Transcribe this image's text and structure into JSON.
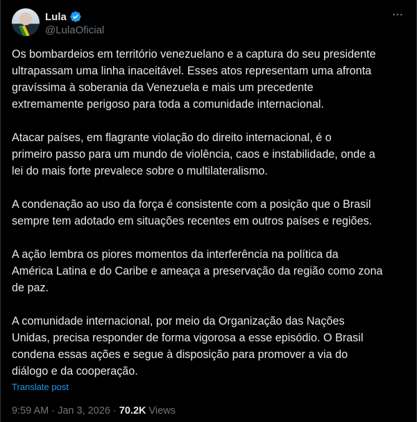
{
  "author": {
    "display_name": "Lula",
    "handle": "@LulaOficial",
    "verified": true,
    "verified_color": "#1d9bf0"
  },
  "paragraphs": [
    "Os bombardeios em território venezuelano e a captura do seu presidente\nultrapassam uma linha inaceitável. Esses atos representam uma afronta\ngravíssima à soberania da Venezuela e mais um precedente\nextremamente perigoso para toda a comunidade internacional.",
    "Atacar países, em flagrante violação do direito internacional, é o\nprimeiro passo para um mundo de violência, caos e instabilidade, onde a\nlei do mais forte prevalece sobre o multilateralismo.",
    "A condenação ao uso da força é consistente com a posição que o Brasil\nsempre tem adotado em situações recentes em outros países e regiões.",
    "A ação lembra os piores momentos da interferência na política da\nAmérica Latina e do Caribe e ameaça a preservação da região como zona\nde paz.",
    "A comunidade internacional, por meio da Organização das Nações\nUnidas, precisa responder de forma vigorosa a esse episódio. O Brasil\ncondena essas ações e segue à disposição para promover a via do\ndiálogo e da cooperação."
  ],
  "translate_label": "Translate post",
  "meta": {
    "time": "9:59 AM",
    "separator": " · ",
    "date": "Jan 3, 2026",
    "views_count": "70.2K",
    "views_label": " Views"
  },
  "more_icon": "more-horizontal-icon",
  "colors": {
    "background": "#000000",
    "text": "#e7e9ea",
    "secondary": "#71767b",
    "link": "#1d9bf0"
  }
}
